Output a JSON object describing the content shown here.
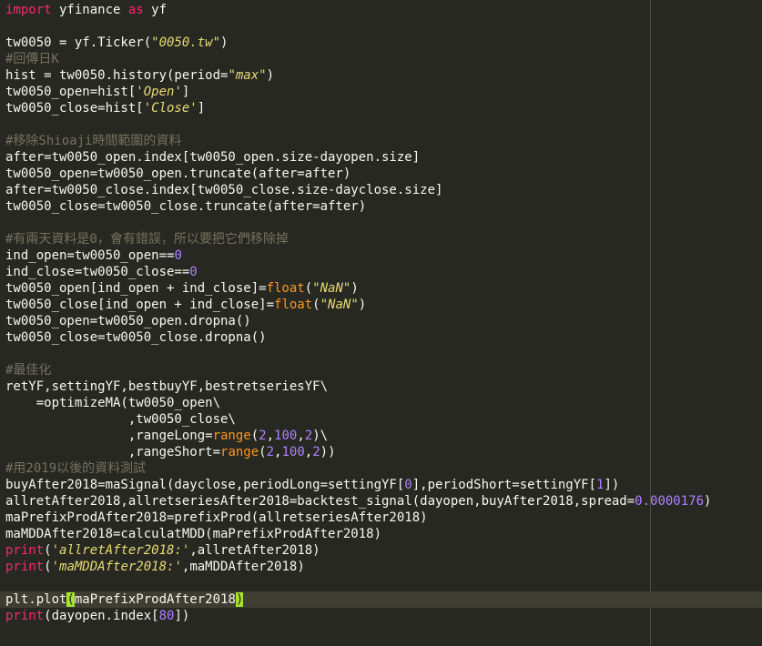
{
  "editor": {
    "lines": [
      [
        {
          "t": "import",
          "c": "k"
        },
        {
          "t": " yfinance ",
          "c": "p"
        },
        {
          "t": "as",
          "c": "k"
        },
        {
          "t": " yf",
          "c": "p"
        }
      ],
      [],
      [
        {
          "t": "tw0050 = yf.Ticker(",
          "c": "p"
        },
        {
          "t": "\"0050.tw\"",
          "c": "s"
        },
        {
          "t": ")",
          "c": "p"
        }
      ],
      [
        {
          "t": "#回傳日K",
          "c": "c"
        }
      ],
      [
        {
          "t": "hist = tw0050.history(period=",
          "c": "p"
        },
        {
          "t": "\"max\"",
          "c": "s"
        },
        {
          "t": ")",
          "c": "p"
        }
      ],
      [
        {
          "t": "tw0050_open=hist[",
          "c": "p"
        },
        {
          "t": "'Open'",
          "c": "s"
        },
        {
          "t": "]",
          "c": "p"
        }
      ],
      [
        {
          "t": "tw0050_close=hist[",
          "c": "p"
        },
        {
          "t": "'Close'",
          "c": "s"
        },
        {
          "t": "]",
          "c": "p"
        }
      ],
      [],
      [
        {
          "t": "#移除Shioaji時間範圍的資料",
          "c": "c"
        }
      ],
      [
        {
          "t": "after=tw0050_open.index[tw0050_open.size-dayopen.size]",
          "c": "p"
        }
      ],
      [
        {
          "t": "tw0050_open=tw0050_open.truncate(after=after)",
          "c": "p"
        }
      ],
      [
        {
          "t": "after=tw0050_close.index[tw0050_close.size-dayclose.size]",
          "c": "p"
        }
      ],
      [
        {
          "t": "tw0050_close=tw0050_close.truncate(after=after)",
          "c": "p"
        }
      ],
      [],
      [
        {
          "t": "#有兩天資料是0，會有錯誤，所以要把它們移除掉",
          "c": "c"
        }
      ],
      [
        {
          "t": "ind_open=tw0050_open==",
          "c": "p"
        },
        {
          "t": "0",
          "c": "n"
        }
      ],
      [
        {
          "t": "ind_close=tw0050_close==",
          "c": "p"
        },
        {
          "t": "0",
          "c": "n"
        }
      ],
      [
        {
          "t": "tw0050_open[ind_open + ind_close]=",
          "c": "p"
        },
        {
          "t": "float",
          "c": "b"
        },
        {
          "t": "(",
          "c": "p"
        },
        {
          "t": "\"NaN\"",
          "c": "s"
        },
        {
          "t": ")",
          "c": "p"
        }
      ],
      [
        {
          "t": "tw0050_close[ind_open + ind_close]=",
          "c": "p"
        },
        {
          "t": "float",
          "c": "b"
        },
        {
          "t": "(",
          "c": "p"
        },
        {
          "t": "\"NaN\"",
          "c": "s"
        },
        {
          "t": ")",
          "c": "p"
        }
      ],
      [
        {
          "t": "tw0050_open=tw0050_open.dropna()",
          "c": "p"
        }
      ],
      [
        {
          "t": "tw0050_close=tw0050_close.dropna()",
          "c": "p"
        }
      ],
      [],
      [
        {
          "t": "#最佳化",
          "c": "c"
        }
      ],
      [
        {
          "t": "retYF,settingYF,bestbuyYF,bestretseriesYF\\",
          "c": "p"
        }
      ],
      [
        {
          "t": "    =optimizeMA(tw0050_open\\",
          "c": "p"
        }
      ],
      [
        {
          "t": "                ,tw0050_close\\",
          "c": "p"
        }
      ],
      [
        {
          "t": "                ,rangeLong=",
          "c": "p"
        },
        {
          "t": "range",
          "c": "b"
        },
        {
          "t": "(",
          "c": "p"
        },
        {
          "t": "2",
          "c": "n"
        },
        {
          "t": ",",
          "c": "p"
        },
        {
          "t": "100",
          "c": "n"
        },
        {
          "t": ",",
          "c": "p"
        },
        {
          "t": "2",
          "c": "n"
        },
        {
          "t": ")\\",
          "c": "p"
        }
      ],
      [
        {
          "t": "                ,rangeShort=",
          "c": "p"
        },
        {
          "t": "range",
          "c": "b"
        },
        {
          "t": "(",
          "c": "p"
        },
        {
          "t": "2",
          "c": "n"
        },
        {
          "t": ",",
          "c": "p"
        },
        {
          "t": "100",
          "c": "n"
        },
        {
          "t": ",",
          "c": "p"
        },
        {
          "t": "2",
          "c": "n"
        },
        {
          "t": "))",
          "c": "p"
        }
      ],
      [
        {
          "t": "#用2019以後的資料測試",
          "c": "c"
        }
      ],
      [
        {
          "t": "buyAfter2018=maSignal(dayclose,periodLong=settingYF[",
          "c": "p"
        },
        {
          "t": "0",
          "c": "n"
        },
        {
          "t": "],periodShort=settingYF[",
          "c": "p"
        },
        {
          "t": "1",
          "c": "n"
        },
        {
          "t": "])",
          "c": "p"
        }
      ],
      [
        {
          "t": "allretAfter2018,allretseriesAfter2018=backtest_signal(dayopen,buyAfter2018,spread=",
          "c": "p"
        },
        {
          "t": "0.0000176",
          "c": "n"
        },
        {
          "t": ")",
          "c": "p"
        }
      ],
      [
        {
          "t": "maPrefixProdAfter2018=prefixProd(allretseriesAfter2018)",
          "c": "p"
        }
      ],
      [
        {
          "t": "maMDDAfter2018=calculatMDD(maPrefixProdAfter2018)",
          "c": "p"
        }
      ],
      [
        {
          "t": "print",
          "c": "k"
        },
        {
          "t": "(",
          "c": "p"
        },
        {
          "t": "'allretAfter2018:'",
          "c": "s"
        },
        {
          "t": ",allretAfter2018)",
          "c": "p"
        }
      ],
      [
        {
          "t": "print",
          "c": "k"
        },
        {
          "t": "(",
          "c": "p"
        },
        {
          "t": "'maMDDAfter2018:'",
          "c": "s"
        },
        {
          "t": ",maMDDAfter2018)",
          "c": "p"
        }
      ],
      [],
      [
        {
          "t": "plt.plot",
          "c": "p"
        },
        {
          "t": "(",
          "c": "bm"
        },
        {
          "t": "maPrefixProdAfter2018",
          "c": "p"
        },
        {
          "t": ")",
          "c": "bm"
        }
      ],
      [
        {
          "t": "print",
          "c": "k"
        },
        {
          "t": "(dayopen.index[",
          "c": "p"
        },
        {
          "t": "80",
          "c": "n"
        },
        {
          "t": "])",
          "c": "p"
        }
      ]
    ],
    "current_line": 36
  }
}
